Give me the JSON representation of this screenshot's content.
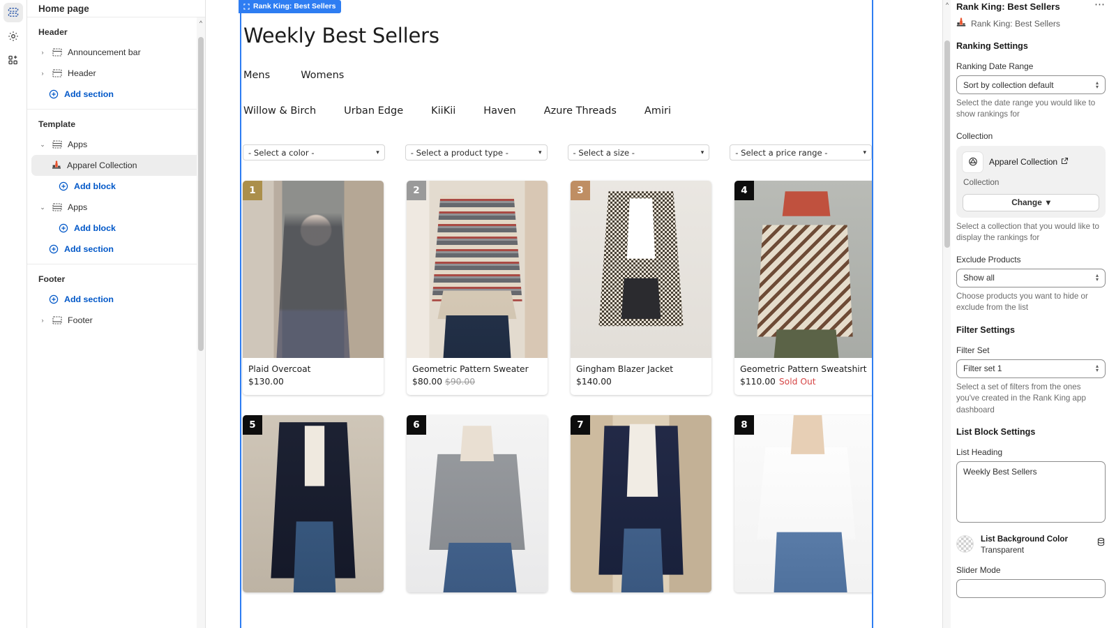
{
  "rail": {
    "items": [
      {
        "name": "sections-icon",
        "label": "Sections",
        "active": true
      },
      {
        "name": "settings-gear-icon",
        "label": "Settings",
        "active": false
      },
      {
        "name": "apps-add-icon",
        "label": "Apps",
        "active": false
      }
    ]
  },
  "sidebar": {
    "title": "Home page",
    "groups": [
      {
        "heading": "Header",
        "rows": [
          {
            "label": "Announcement bar",
            "kind": "section",
            "caret": "›",
            "icon": "section-icon"
          },
          {
            "label": "Header",
            "kind": "section",
            "caret": "›",
            "icon": "section-icon"
          },
          {
            "label": "Add section",
            "kind": "add",
            "icon": "plus-circle-icon"
          }
        ]
      },
      {
        "heading": "Template",
        "rows": [
          {
            "label": "Apps",
            "kind": "section",
            "caret": "⌄",
            "icon": "section-icon"
          },
          {
            "label": "Apparel Collection",
            "kind": "block",
            "selected": true,
            "icon": "rank-king-icon"
          },
          {
            "label": "Add block",
            "kind": "add-block",
            "icon": "plus-circle-icon"
          },
          {
            "label": "Apps",
            "kind": "section",
            "caret": "⌄",
            "icon": "section-icon"
          },
          {
            "label": "Add block",
            "kind": "add-block",
            "icon": "plus-circle-icon"
          },
          {
            "label": "Add section",
            "kind": "add",
            "icon": "plus-circle-icon"
          }
        ]
      },
      {
        "heading": "Footer",
        "rows": [
          {
            "label": "Add section",
            "kind": "add",
            "icon": "plus-circle-icon"
          },
          {
            "label": "Footer",
            "kind": "section",
            "caret": "›",
            "icon": "footer-icon"
          }
        ]
      }
    ]
  },
  "canvas": {
    "section_tag": "Rank King: Best Sellers",
    "heading": "Weekly Best Sellers",
    "primary_tabs": [
      "Mens",
      "Womens"
    ],
    "brand_tabs": [
      "Willow & Birch",
      "Urban Edge",
      "KiiKii",
      "Haven",
      "Azure Threads",
      "Amiri"
    ],
    "filters": [
      "- Select a color -",
      "- Select a product type -",
      "- Select a size -",
      "- Select a price range -"
    ],
    "products_row1": [
      {
        "rank": "1",
        "title": "Plaid Overcoat",
        "price": "$130.00",
        "compare_at": "",
        "sold_out": "",
        "badge_color": "#ab8f4b"
      },
      {
        "rank": "2",
        "title": "Geometric Pattern Sweater",
        "price": "$80.00",
        "compare_at": "$90.00",
        "sold_out": "",
        "badge_color": "#9a9a9a"
      },
      {
        "rank": "3",
        "title": "Gingham Blazer Jacket",
        "price": "$140.00",
        "compare_at": "",
        "sold_out": "",
        "badge_color": "#bf8e63"
      },
      {
        "rank": "4",
        "title": "Geometric Pattern Sweatshirt",
        "price": "$110.00",
        "compare_at": "",
        "sold_out": "Sold Out",
        "badge_color": "#0d0d0d"
      }
    ],
    "products_row2": [
      {
        "rank": "5",
        "title": "",
        "price": "",
        "badge_color": "#0d0d0d"
      },
      {
        "rank": "6",
        "title": "",
        "price": "",
        "badge_color": "#0d0d0d"
      },
      {
        "rank": "7",
        "title": "",
        "price": "",
        "badge_color": "#0d0d0d"
      },
      {
        "rank": "8",
        "title": "",
        "price": "",
        "badge_color": "#0d0d0d"
      }
    ]
  },
  "settings": {
    "title": "Rank King: Best Sellers",
    "app_name": "Rank King: Best Sellers",
    "menu_dots": "⋯",
    "ranking_settings_heading": "Ranking Settings",
    "date_range_label": "Ranking Date Range",
    "date_range_value": "Sort by collection default",
    "date_range_help": "Select the date range you would like to show rankings for",
    "collection_label": "Collection",
    "collection_name": "Apparel Collection",
    "collection_type": "Collection",
    "change_button": "Change",
    "collection_help": "Select a collection that you would like to display the rankings for",
    "exclude_label": "Exclude Products",
    "exclude_value": "Show all",
    "exclude_help": "Choose products you want to hide or exclude from the list",
    "filter_settings_heading": "Filter Settings",
    "filter_set_label": "Filter Set",
    "filter_set_value": "Filter set 1",
    "filter_set_help": "Select a set of filters from the ones you've created in the Rank King app dashboard",
    "list_block_heading": "List Block Settings",
    "list_heading_label": "List Heading",
    "list_heading_value": "Weekly Best Sellers",
    "bg_color_label": "List Background Color",
    "bg_color_value": "Transparent",
    "slider_mode_label": "Slider Mode"
  },
  "colors": {
    "accent_blue": "#2e7df2",
    "link_blue": "#0057c8",
    "sold_out_red": "#d64545",
    "brand_orange": "#e8502a"
  }
}
